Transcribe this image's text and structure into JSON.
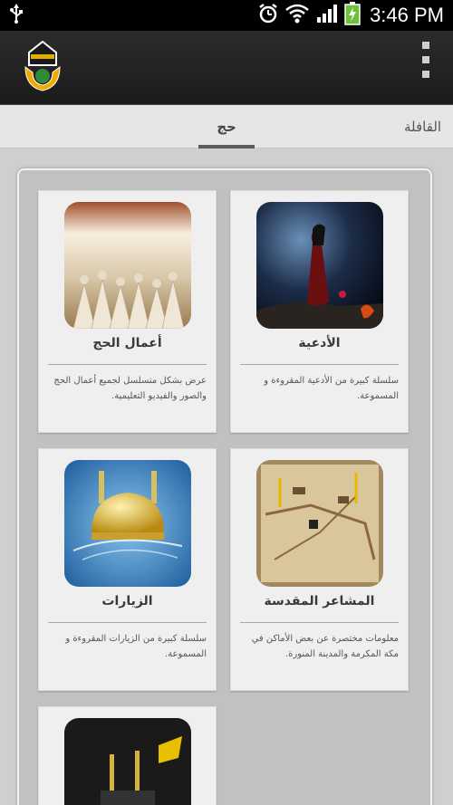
{
  "status_bar": {
    "time": "3:46 PM"
  },
  "tabs": [
    {
      "label": "حج",
      "active": true
    },
    {
      "label": "القافلة",
      "active": false
    }
  ],
  "cards": [
    {
      "title": "الأدعية",
      "description": "سلسلة كبيرة من الأدعية المقروءة و المسموعة."
    },
    {
      "title": "أعمال الحج",
      "description": "عرض بشكل متسلسل لجميع أعمال الحج والصور والفيديو التعليمية."
    },
    {
      "title": "المشاعر المقدسة",
      "description": "معلومات مختصرة عن بعض الأماكن في مكة المكرمة والمدينة المنورة."
    },
    {
      "title": "الزيارات",
      "description": "سلسلة كبيرة من الزيارات المقروءة و المسموعة."
    }
  ],
  "colors": {
    "action_bar": "#1f1f1f",
    "status_bar": "#000000",
    "tab_indicator": "#5b5b5b",
    "card_bg": "#efefef"
  },
  "icons": [
    "usb-icon",
    "alarm-icon",
    "wifi-icon",
    "signal-icon",
    "battery-charging-icon",
    "app-logo-icon",
    "overflow-menu-icon"
  ]
}
